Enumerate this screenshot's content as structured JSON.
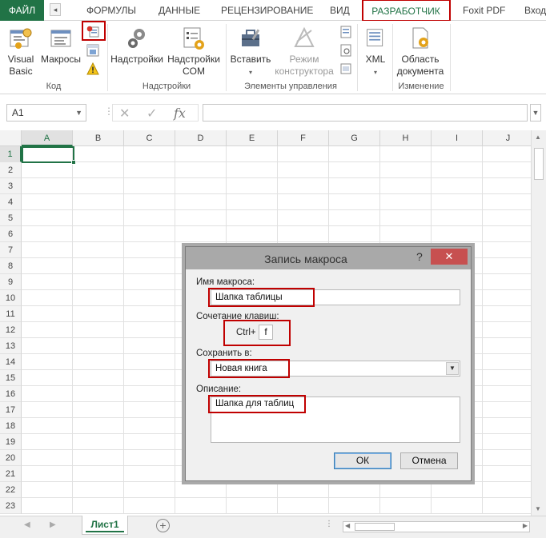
{
  "tabs": {
    "file": "ФАЙЛ",
    "formulas": "ФОРМУЛЫ",
    "data": "ДАННЫЕ",
    "review": "РЕЦЕНЗИРОВАНИЕ",
    "view": "ВИД",
    "developer": "РАЗРАБОТЧИК",
    "foxit": "Foxit PDF",
    "signin": "Вход"
  },
  "ribbon": {
    "vb_label1": "Visual",
    "vb_label2": "Basic",
    "macros_label": "Макросы",
    "group_code": "Код",
    "addins_label": "Надстройки",
    "com_addins_label1": "Надстройки",
    "com_addins_label2": "COM",
    "group_addins": "Надстройки",
    "insert_label": "Вставить",
    "design_label1": "Режим",
    "design_label2": "конструктора",
    "group_controls": "Элементы управления",
    "xml_label": "XML",
    "docpanel_label1": "Область",
    "docpanel_label2": "документа",
    "group_modify": "Изменение"
  },
  "formula_bar": {
    "name_box": "A1",
    "fx": "fx",
    "value": ""
  },
  "grid": {
    "columns": [
      "A",
      "B",
      "C",
      "D",
      "E",
      "F",
      "G",
      "H",
      "I",
      "J"
    ],
    "rows": [
      "1",
      "2",
      "3",
      "4",
      "5",
      "6",
      "7",
      "8",
      "9",
      "10",
      "11",
      "12",
      "13",
      "14",
      "15",
      "16",
      "17",
      "18",
      "19",
      "20",
      "21",
      "22",
      "23"
    ],
    "active_cell": "A1"
  },
  "sheets": {
    "active": "Лист1"
  },
  "dialog": {
    "title": "Запись макроса",
    "help": "?",
    "close": "✕",
    "macro_name_label": "Имя макроса:",
    "macro_name_value": "Шапка таблицы",
    "shortcut_label": "Сочетание клавиш:",
    "shortcut_prefix": "Ctrl+",
    "shortcut_key": "f",
    "store_in_label": "Сохранить в:",
    "store_in_value": "Новая книга",
    "description_label": "Описание:",
    "description_value": "Шапка для таблиц",
    "ok": "ОК",
    "cancel": "Отмена"
  },
  "colors": {
    "excel_green": "#217346",
    "highlight_red": "#c00000",
    "dialog_title": "#a9a9a9",
    "close_red": "#c75050"
  }
}
